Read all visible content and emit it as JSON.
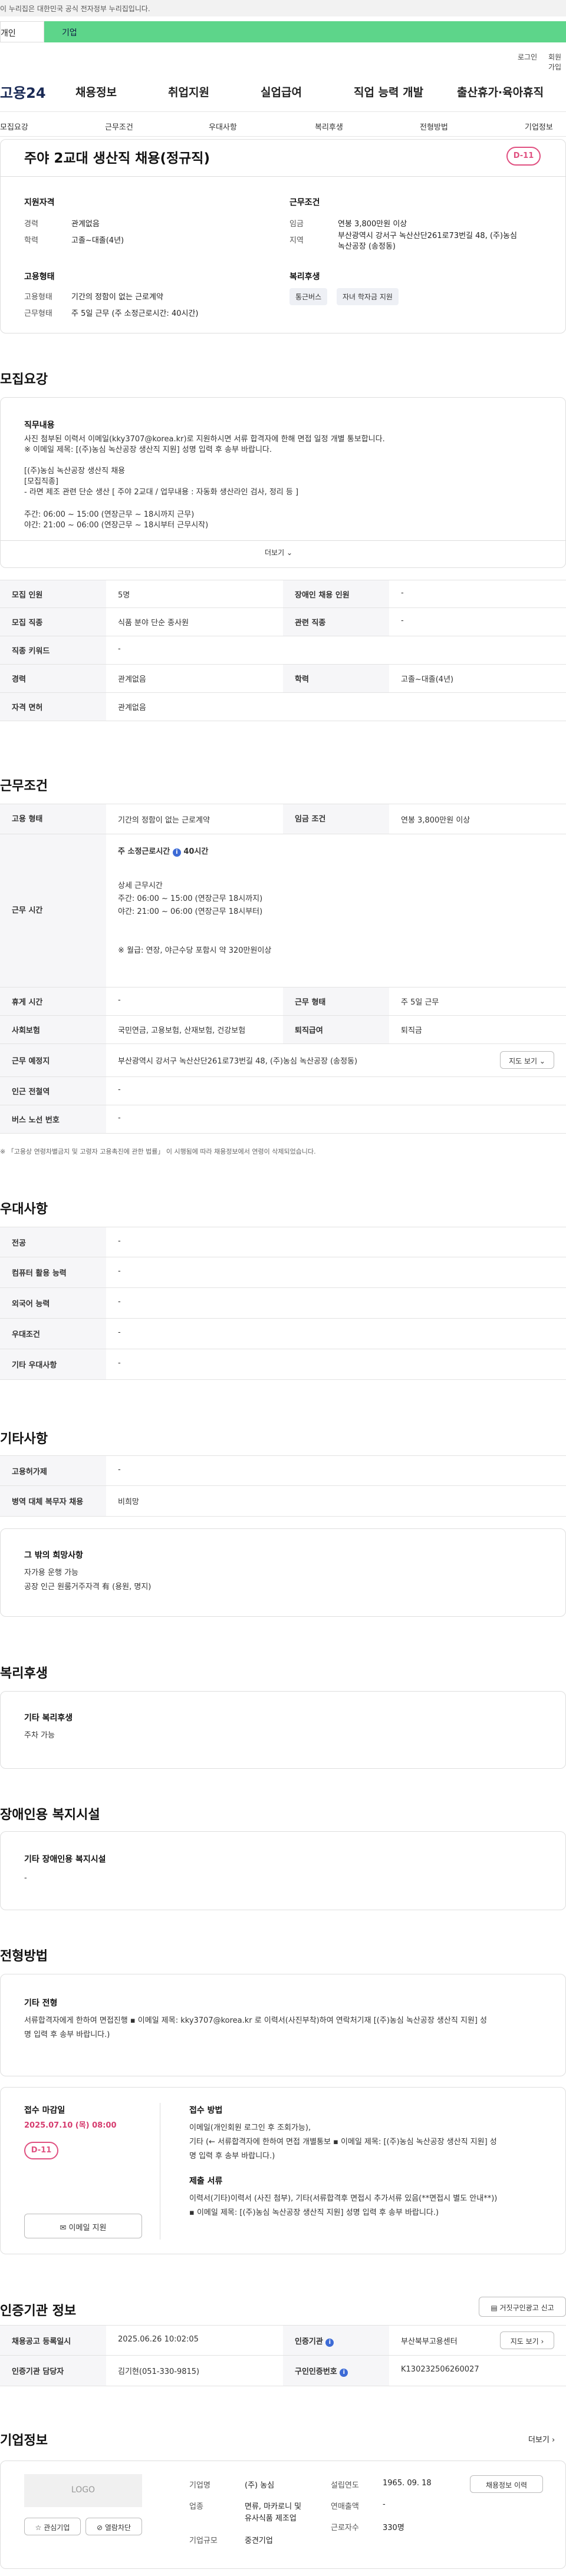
{
  "gov_bar": {
    "text": "이 누리집은 대한민국 공식 전자정부 누리집입니다."
  },
  "tabs": {
    "t1": "개인",
    "t2": "기업"
  },
  "util": {
    "login": "로그인",
    "signup": "회원가입"
  },
  "gnb": {
    "logo": "고용24",
    "menu": [
      "채용정보",
      "취업지원",
      "실업급여",
      "직업 능력 개발",
      "출산휴가·육아휴직"
    ]
  },
  "subnav": [
    "모집요강",
    "근무조건",
    "우대사항",
    "복리후생",
    "전형방법",
    "기업정보"
  ],
  "summary": {
    "title": "주야 2교대 생산직 채용(정규직)",
    "dday": "D-11",
    "qual_head": "지원자격",
    "career_lab": "경력",
    "career_val": "관계없음",
    "edu_lab": "학력",
    "edu_val": "고졸~대졸(4년)",
    "emp_head": "고용형태",
    "emp_type_lab": "고용형태",
    "emp_type_val": "기간의 정함이 없는 근로계약",
    "work_form_lab": "근무형태",
    "work_form_val": "주 5일 근무 (주 소정근로시간: 40시간)",
    "cond_head": "근무조건",
    "wage_lab": "임금",
    "wage_val": "연봉 3,800만원 이상",
    "region_lab": "지역",
    "region_val1": "부산광역시 강서구 녹산산단261로73번길 48, (주)농심",
    "region_val2": "녹산공장 (송정동)",
    "welfare_head": "복리후생",
    "welfare_chips": [
      "통근버스",
      "자녀 학자금 지원"
    ]
  },
  "recruit": {
    "section_title": "모집요강",
    "duty_head": "직무내용",
    "duty_lines": [
      "사진 첨부된 이력서 이메일(kky3707@korea.kr)로 지원하시면 서류 합격자에 한해 면접 일정 개별 통보합니다.",
      "※ 이메일 제목: [(주)농심 녹산공장 생산직 지원] 성명 입력 후 송부 바랍니다.",
      "",
      "[(주)농심 녹산공장 생산직 채용",
      "[모집직종]",
      "- 라면 제조 관련 단순 생산 [ 주야 2교대 / 업무내용 : 자동화 생산라인 검사, 정리 등 ]",
      "",
      "주간: 06:00 ~ 15:00 (연장근무 ~ 18시까지 근무)",
      "야간: 21:00 ~ 06:00 (연장근무 ~ 18시부터 근무시작)"
    ],
    "more": "더보기",
    "rows": [
      {
        "l1": "모집 인원",
        "v1": "5명",
        "l2": "장애인 채용 인원",
        "v2": "-"
      },
      {
        "l1": "모집 직종",
        "v1": "식품 분야 단순 종사원",
        "l2": "관련 직종",
        "v2": "-"
      },
      {
        "l1": "직종 키워드",
        "v1": "-"
      },
      {
        "l1": "경력",
        "v1": "관계없음",
        "l2": "학력",
        "v2": "고졸~대졸(4년)"
      },
      {
        "l1": "자격 면허",
        "v1": "관계없음"
      }
    ]
  },
  "work": {
    "section_title": "근무조건",
    "emp_lab": "고용 형태",
    "emp_val": "기간의 정함이 없는 근로계약",
    "wage_lab": "임금 조건",
    "wage_val": "연봉 3,800만원 이상",
    "time_lab": "근무 시간",
    "time_week": "주 소정근로시간",
    "time_week_val": "40시간",
    "time_detail_head": "상세 근무시간",
    "time_d1": "주간: 06:00 ~ 15:00 (연장근무 18시까지)",
    "time_d2": "야간: 21:00 ~ 06:00 (연장근무 18시부터)",
    "time_d3": "※ 월급: 연장, 야근수당 포함시 약 320만원이상",
    "rest_lab": "휴게 시간",
    "rest_val": "-",
    "form_lab": "근무 형태",
    "form_val": "주 5일 근무",
    "ins_lab": "사회보험",
    "ins_val": "국민연금, 고용보험, 산재보험, 건강보험",
    "sev_lab": "퇴직급여",
    "sev_val": "퇴직금",
    "place_lab": "근무 예정지",
    "place_val": "부산광역시 강서구 녹산산단261로73번길 48, (주)농심 녹산공장 (송정동)",
    "map_btn": "지도 보기",
    "sub_lab": "인근 전철역",
    "sub_val": "-",
    "bus_lab": "버스 노선 번호",
    "bus_val": "-",
    "note": "※ 「고용상 연령차별금지 및 고령자 고용촉진에 관한 법률」 이 시행됨에 따라 채용정보에서 연령이 삭제되었습니다."
  },
  "pref": {
    "section_title": "우대사항",
    "rows": [
      {
        "l": "전공",
        "v": "-"
      },
      {
        "l": "컴퓨터 활용 능력",
        "v": "-"
      },
      {
        "l": "외국어 능력",
        "v": "-"
      },
      {
        "l": "우대조건",
        "v": "-"
      },
      {
        "l": "기타 우대사항",
        "v": "-"
      }
    ]
  },
  "etc": {
    "section_title": "기타사항",
    "disab_lab": "고용허가제",
    "disab_val": "-",
    "army_lab": "병역 대체 복무자 채용",
    "army_val": "비희망",
    "hope_head": "그 밖의 희망사항",
    "hope_l1": "자가용 운행 가능",
    "hope_l2": "공장 인근 원룸거주자격 有 (용원, 명지)"
  },
  "welfare": {
    "section_title": "복리후생",
    "head": "기타 복리후생",
    "val": "주차 가능"
  },
  "facility": {
    "section_title": "장애인용 복지시설",
    "head": "기타 장애인용 복지시설",
    "val": "-"
  },
  "selection": {
    "section_title": "전형방법",
    "method_head": "기타 전형",
    "method_l1": "서류합격자에게 한하여 면접진행 ▪ 이메일 제목: kky3707@korea.kr 로 이력서(사진부착)하여 연락처기재 [(주)농심 녹산공장 생산직 지원] 성",
    "method_l2": "명 입력 후 송부 바랍니다.)",
    "deadline_head": "접수 마감일",
    "deadline_val": "2025.07.10 (목) 08:00",
    "dday": "D-11",
    "apply_btn": "이메일 지원",
    "how_head": "접수 방법",
    "how_l1": "이메일(개인회원 로그인 후 조회가능),",
    "how_l2": "기타 (← 서류합격자에 한하여 면접 개별통보 ▪ 이메일 제목: [(주)농심 녹산공장 생산직 지원] 성",
    "how_l3": "명 입력 후 송부 바랍니다.)",
    "doc_head": "제출 서류",
    "doc_l1": "이력서(기타)이력서 (사진 첨부), 기타(서류합격후 면접시 추가서류 있음(**면접시 별도 안내**))",
    "doc_l2": "▪ 이메일 제목: [(주)농심 녹산공장 생산직 지원] 성명 입력 후 송부 바랍니다.)"
  },
  "agency": {
    "section_title": "인증기관 정보",
    "report_btn": "거짓구인광고 신고",
    "reg_lab": "채용공고 등록일시",
    "reg_val": "2025.06.26 10:02:05",
    "org_lab": "인증기관",
    "org_val": "부산북부고용센터",
    "map_btn": "지도 보기",
    "mgr_lab": "인증기관 담당자",
    "mgr_val": "김기현(051-330-9815)",
    "num_lab": "구인인증번호",
    "num_val": "K130232506260027"
  },
  "company": {
    "section_title": "기업정보",
    "more": "더보기",
    "logo": "LOGO",
    "fav_btn": "관심기업",
    "block_btn": "열람차단",
    "info_btn": "채용정보 이력",
    "name_lab": "기업명",
    "name_val": "(주) 농심",
    "found_lab": "설립연도",
    "found_val": "1965. 09. 18",
    "ind_lab": "업종",
    "ind_val1": "면류, 마카로니 및",
    "ind_val2": "유사식품 제조업",
    "sales_lab": "연매출액",
    "sales_val": "-",
    "emp_lab": "근로자수",
    "emp_val": "330명",
    "size_lab": "기업규모",
    "size_val": "중견기업"
  }
}
